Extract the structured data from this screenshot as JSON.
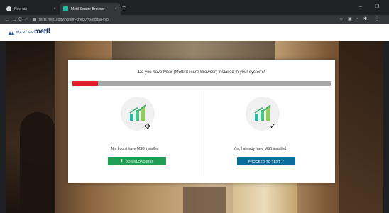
{
  "browser": {
    "tabs": [
      {
        "label": "New tab",
        "close": "×"
      },
      {
        "label": "Mettl Secure Browser",
        "close": "×"
      }
    ],
    "new_tab": "+",
    "window_controls": "–  ❐",
    "nav": {
      "back": "←",
      "forward": "→",
      "reload": "C",
      "home": "⌂"
    },
    "url": "tests.mettl.com/system-check/ms-install-info",
    "extensions": {
      "star": "☆",
      "ext1": "▣",
      "ext2": "•",
      "ext3": "✱",
      "menu": "⋮"
    }
  },
  "site": {
    "brand_mercer": "MERCER",
    "brand_mettl": "mettl",
    "colors": {
      "mercer": "#1f4fa0",
      "mettl": "#1f3a66",
      "mettl_accent": "#16b2c4"
    }
  },
  "modal": {
    "question": "Do you have MSB (Mettl Secure Browser) installed in your system?",
    "progress": 0.1,
    "progress_color": "#dc1f28",
    "left": {
      "icon": "mettl-logo-icon",
      "badge_icon": "gear-icon",
      "badge": "⚙",
      "label": "No, I don't have MSB installed",
      "button_icon": "download-icon",
      "button_icon_glyph": "⬇",
      "button": "DOWNLOAD MSB",
      "button_color": "#1e9f55"
    },
    "right": {
      "icon": "mettl-logo-icon",
      "badge_icon": "checkmark-icon",
      "badge": "✓",
      "label": "Yes, I already have MSB installed",
      "button": "PROCEED TO TEST",
      "button_arrow": "›",
      "button_color": "#0b6d9c"
    }
  }
}
